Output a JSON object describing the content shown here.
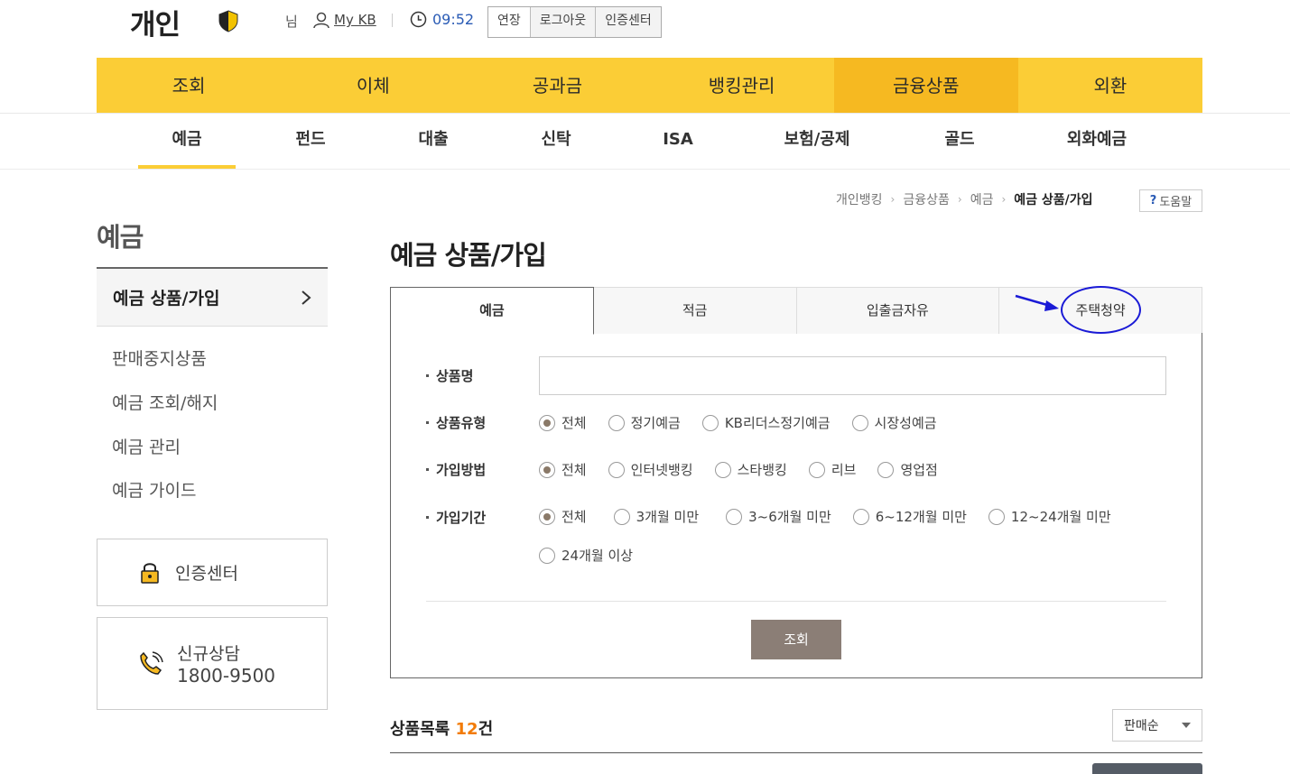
{
  "header": {
    "brand": "개인",
    "user_suffix": "님",
    "mykb_label": "My KB",
    "timer": "09:52",
    "session_buttons": [
      "연장",
      "로그아웃",
      "인증센터"
    ]
  },
  "gnb": {
    "items": [
      "조회",
      "이체",
      "공과금",
      "뱅킹관리",
      "금융상품",
      "외환"
    ],
    "active_index": 4
  },
  "subnav": {
    "items": [
      "예금",
      "펀드",
      "대출",
      "신탁",
      "ISA",
      "보험/공제",
      "골드",
      "외화예금"
    ],
    "active_index": 0
  },
  "breadcrumb": {
    "items": [
      "개인뱅킹",
      "금융상품",
      "예금",
      "예금 상품/가입"
    ],
    "help_label": "도움말",
    "help_mark": "?"
  },
  "sidebar": {
    "title": "예금",
    "active_item": "예금 상품/가입",
    "items": [
      "판매중지상품",
      "예금 조회/해지",
      "예금 관리",
      "예금 가이드"
    ],
    "cert_center": "인증센터",
    "consult_label": "신규상담",
    "consult_phone": "1800-9500"
  },
  "main": {
    "title": "예금 상품/가입",
    "tabs": [
      "예금",
      "적금",
      "입출금자유",
      "주택청약"
    ],
    "active_tab": 0,
    "form": {
      "product_name_label": "상품명",
      "product_name_value": "",
      "product_type_label": "상품유형",
      "product_type_options": [
        "전체",
        "정기예금",
        "KB리더스정기예금",
        "시장성예금"
      ],
      "join_method_label": "가입방법",
      "join_method_options": [
        "전체",
        "인터넷뱅킹",
        "스타뱅킹",
        "리브",
        "영업점"
      ],
      "join_period_label": "가입기간",
      "join_period_options": [
        "전체",
        "3개월 미만",
        "3~6개월 미만",
        "6~12개월 미만",
        "12~24개월 미만",
        "24개월 이상"
      ],
      "search_button": "조회"
    },
    "list": {
      "title": "상품목록",
      "count": "12",
      "count_unit": "건",
      "sort_selected": "판매순"
    }
  },
  "colors": {
    "gnb_bg": "#fbcd36",
    "gnb_active": "#f6b921",
    "accent_blue": "#2a5bb5",
    "count_orange": "#f27b07",
    "annotation_blue": "#1a1ad6"
  }
}
